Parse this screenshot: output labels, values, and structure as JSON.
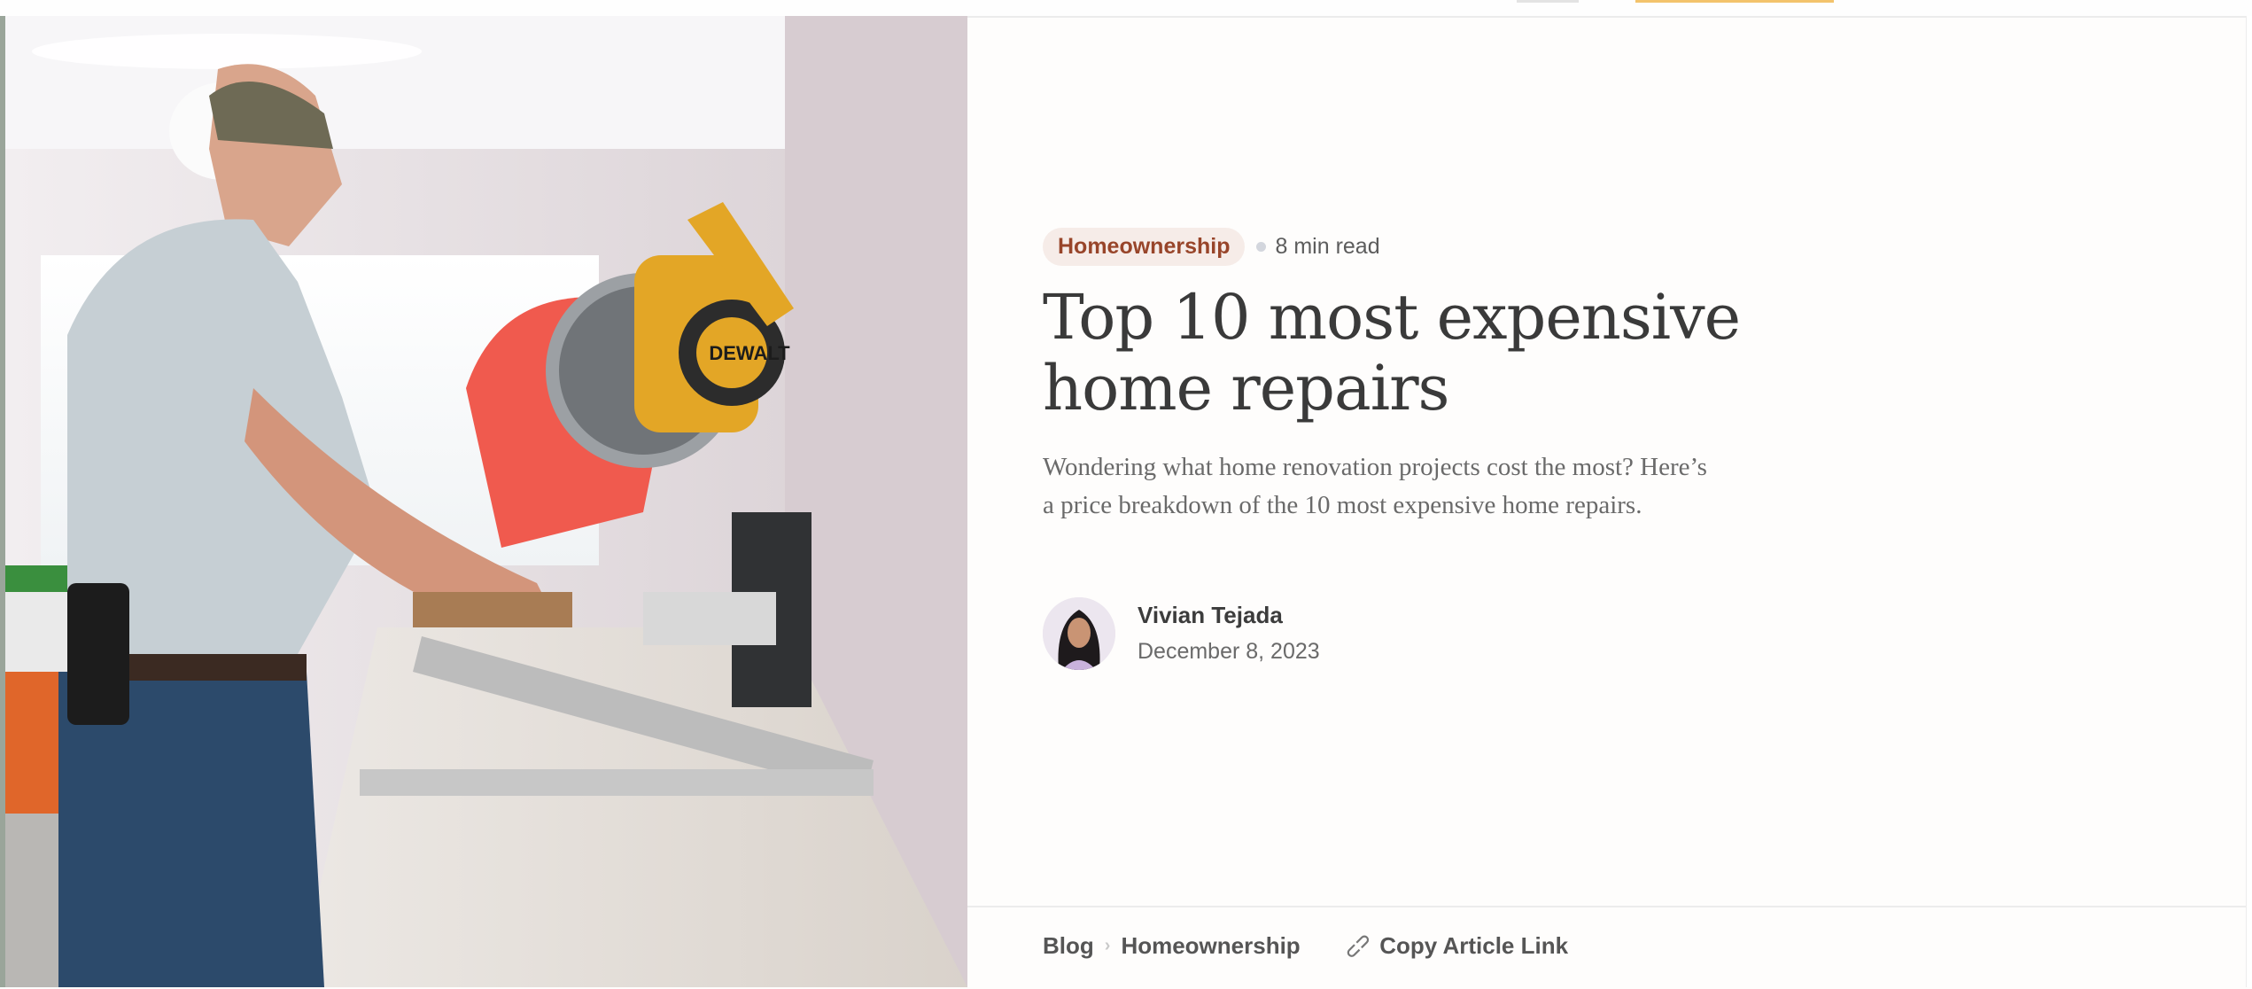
{
  "article": {
    "category": "Homeownership",
    "read_time": "8 min read",
    "title_line1": "Top 10 most expensive",
    "title_line2": "home repairs",
    "subtitle_line1": "Wondering what home renovation projects cost the most? Here’s",
    "subtitle_line2": "a price breakdown of the 10 most expensive home repairs."
  },
  "author": {
    "name": "Vivian Tejada",
    "date": "December 8, 2023"
  },
  "breadcrumb": {
    "items": [
      "Blog",
      "Homeownership"
    ],
    "copy_link_label": "Copy Article Link"
  },
  "hero_image": {
    "saw_brand": "DEWALT"
  },
  "colors": {
    "tag_background": "#f6ece8",
    "tag_text": "#98452a",
    "title_text": "#3a3a3a",
    "accent_yellow": "#f3c36c"
  }
}
